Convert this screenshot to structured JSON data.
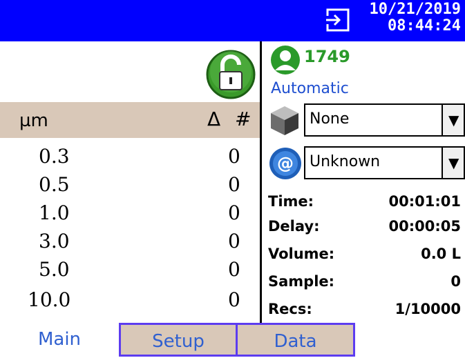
{
  "status_bar": {
    "date": "10/21/2019",
    "time": "08:44:24"
  },
  "table": {
    "header": {
      "size_unit": "µm",
      "delta": "Δ",
      "count": "#"
    },
    "rows": [
      {
        "size": "0.3",
        "count": "0"
      },
      {
        "size": "0.5",
        "count": "0"
      },
      {
        "size": "1.0",
        "count": "0"
      },
      {
        "size": "3.0",
        "count": "0"
      },
      {
        "size": "5.0",
        "count": "0"
      },
      {
        "size": "10.0",
        "count": "0"
      }
    ]
  },
  "right_panel": {
    "user_id": "1749",
    "mode": "Automatic",
    "location_select": "None",
    "network_select": "Unknown",
    "stats": [
      {
        "label": "Time:",
        "value": "00:01:01"
      },
      {
        "label": "Delay:",
        "value": "00:00:05"
      },
      {
        "label": "Volume:",
        "value": "0.0 L"
      },
      {
        "label": "Sample:",
        "value": "0"
      },
      {
        "label": "Recs:",
        "value": "1/10000"
      }
    ]
  },
  "tabs": [
    "Main",
    "Setup",
    "Data"
  ],
  "colors": {
    "topbar": "#0000ff",
    "header_bg": "#d9c8b8",
    "accent": "#5c3cf0",
    "user_green": "#2a9a2a"
  },
  "icons": [
    "export-icon",
    "lock-open-icon",
    "user-icon",
    "cube-icon",
    "at-icon",
    "dropdown-arrow-icon"
  ]
}
